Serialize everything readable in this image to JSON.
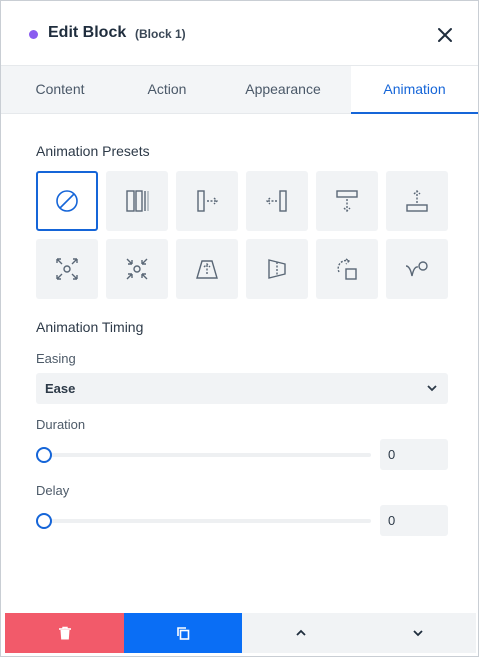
{
  "header": {
    "title": "Edit Block",
    "subtitle": "(Block 1)",
    "close_icon": "close-icon"
  },
  "tabs": [
    {
      "label": "Content",
      "active": false
    },
    {
      "label": "Action",
      "active": false
    },
    {
      "label": "Appearance",
      "active": false
    },
    {
      "label": "Animation",
      "active": true
    }
  ],
  "presets": {
    "title": "Animation Presets",
    "items": [
      {
        "icon": "none-icon",
        "selected": true
      },
      {
        "icon": "fade-bars-icon",
        "selected": false
      },
      {
        "icon": "slide-right-icon",
        "selected": false
      },
      {
        "icon": "slide-left-icon",
        "selected": false
      },
      {
        "icon": "slide-down-icon",
        "selected": false
      },
      {
        "icon": "slide-up-icon",
        "selected": false
      },
      {
        "icon": "zoom-out-icon",
        "selected": false
      },
      {
        "icon": "zoom-in-icon",
        "selected": false
      },
      {
        "icon": "flip-up-icon",
        "selected": false
      },
      {
        "icon": "flip-side-icon",
        "selected": false
      },
      {
        "icon": "rotate-icon",
        "selected": false
      },
      {
        "icon": "bounce-icon",
        "selected": false
      }
    ]
  },
  "timing": {
    "title": "Animation Timing",
    "easing_label": "Easing",
    "easing_value": "Ease",
    "duration_label": "Duration",
    "duration_value": "0",
    "delay_label": "Delay",
    "delay_value": "0"
  },
  "footer": {
    "delete_icon": "trash-icon",
    "duplicate_icon": "duplicate-icon",
    "move_up_icon": "chevron-up-icon",
    "move_down_icon": "chevron-down-icon"
  },
  "colors": {
    "accent": "#1565d8",
    "purple_dot": "#8a5cf0",
    "delete": "#f25a6a",
    "duplicate": "#0a6ef5",
    "neutral": "#f1f3f5"
  }
}
